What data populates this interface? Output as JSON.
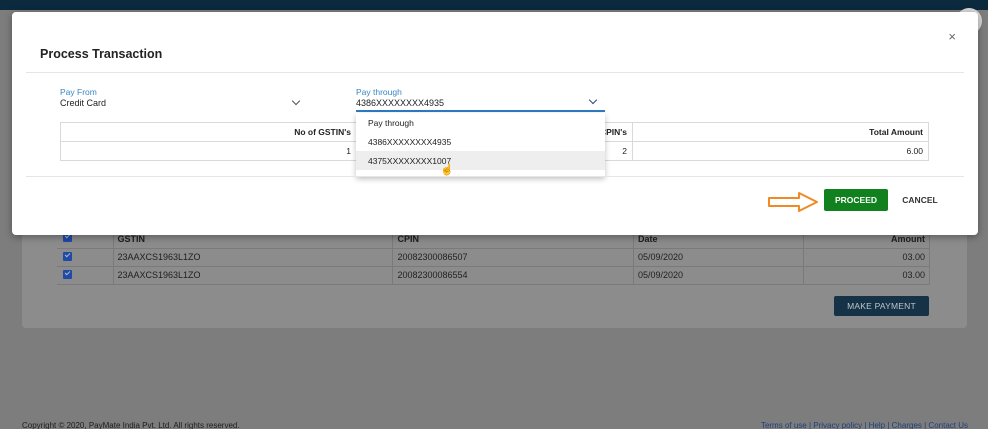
{
  "header": {},
  "background": {
    "table": {
      "headers": [
        "",
        "GSTIN",
        "CPIN",
        "Date",
        "Amount"
      ],
      "rows": [
        {
          "gstin": "23AAXCS1963L1ZO",
          "cpin": "20082300086507",
          "date": "05/09/2020",
          "amount": "03.00"
        },
        {
          "gstin": "23AAXCS1963L1ZO",
          "cpin": "20082300086554",
          "date": "05/09/2020",
          "amount": "03.00"
        }
      ]
    },
    "make_payment_label": "MAKE PAYMENT"
  },
  "footer": {
    "copyright": "Copyright © 2020, PayMate India Pvt. Ltd. All rights reserved.",
    "links": "Terms of use | Privacy policy | Help | Charges | Contact Us"
  },
  "modal": {
    "title": "Process Transaction",
    "close": "×",
    "pay_from": {
      "label": "Pay From",
      "value": "Credit Card"
    },
    "pay_through": {
      "label": "Pay through",
      "value": "4386XXXXXXXX4935"
    },
    "summary": {
      "headers": {
        "gstins": "No of GSTIN's",
        "cpins": "CPIN's",
        "total": "Total Amount"
      },
      "values": {
        "gstins": "1",
        "cpins": "2",
        "total": "6.00"
      }
    },
    "dropdown": {
      "options": [
        "Pay through",
        "4386XXXXXXXX4935",
        "4375XXXXXXXX1007"
      ],
      "highlighted_index": 2
    },
    "proceed_label": "PROCEED",
    "cancel_label": "CANCEL"
  },
  "colors": {
    "accent_blue": "#2e7bc4",
    "proceed_green": "#11801e",
    "arrow_orange": "#f08a24"
  }
}
